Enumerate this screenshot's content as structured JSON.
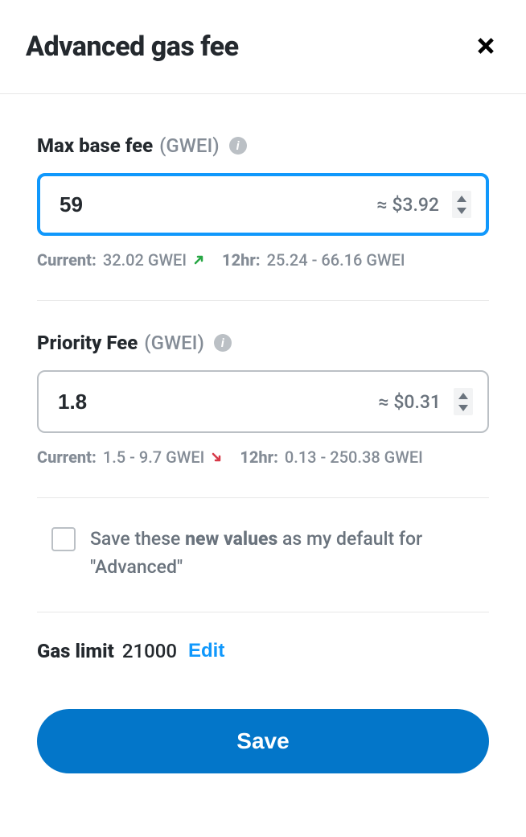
{
  "title": "Advanced gas fee",
  "max_base_fee": {
    "label": "Max base fee",
    "unit": "(GWEI)",
    "value": "59",
    "fiat": "≈ $3.92",
    "current_label": "Current:",
    "current_value": "32.02 GWEI",
    "trend": "up",
    "range_label": "12hr:",
    "range_value": "25.24 - 66.16 GWEI"
  },
  "priority_fee": {
    "label": "Priority Fee",
    "unit": "(GWEI)",
    "value": "1.8",
    "fiat": "≈ $0.31",
    "current_label": "Current:",
    "current_value": "1.5 - 9.7 GWEI",
    "trend": "down",
    "range_label": "12hr:",
    "range_value": "0.13 - 250.38 GWEI"
  },
  "save_default": {
    "prefix": "Save these ",
    "bold": "new values",
    "suffix": " as my default for \"Advanced\""
  },
  "gas_limit": {
    "label": "Gas limit",
    "value": "21000",
    "edit": "Edit"
  },
  "save_button": "Save"
}
